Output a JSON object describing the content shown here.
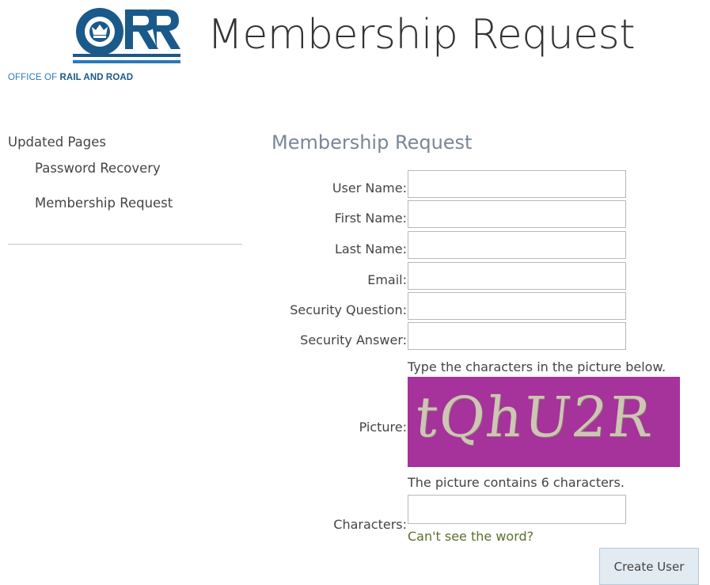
{
  "header": {
    "logo_mark": "ORR",
    "logo_org_light": "OFFICE OF ",
    "logo_org_bold": "RAIL AND ROAD",
    "site_title": "Membership Request"
  },
  "nav": {
    "heading": "Updated Pages",
    "items": [
      {
        "label": "Password Recovery"
      },
      {
        "label": "Membership Request"
      }
    ]
  },
  "form": {
    "title": "Membership Request",
    "fields": [
      {
        "label": "User Name:",
        "value": ""
      },
      {
        "label": "First Name:",
        "value": ""
      },
      {
        "label": "Last Name:",
        "value": ""
      },
      {
        "label": "Email:",
        "value": ""
      },
      {
        "label": "Security Question:",
        "value": ""
      },
      {
        "label": "Security Answer:",
        "value": ""
      }
    ],
    "captcha_instruction": "Type the characters in the picture below.",
    "picture_label": "Picture:",
    "captcha_text": "tQhU2R",
    "captcha_count_text": "The picture contains 6 characters.",
    "characters_label": "Characters:",
    "characters_value": "",
    "cant_see_link": "Can't see the word?",
    "submit_label": "Create User"
  },
  "colors": {
    "logo_blue": "#1a5a8a",
    "captcha_bg": "#a6329b",
    "link": "#5b6f2c",
    "button_bg": "#e3ebf2"
  }
}
